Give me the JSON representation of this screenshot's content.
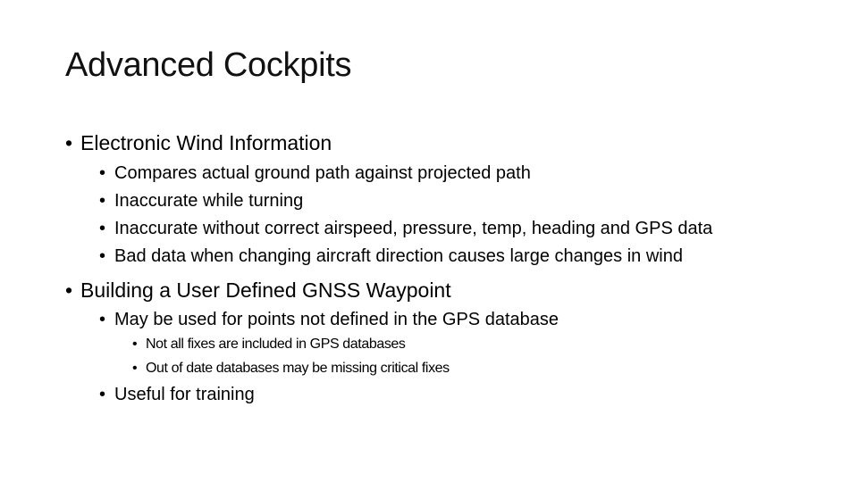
{
  "slide": {
    "title": "Advanced Cockpits",
    "bullet_glyph": "•",
    "sections": [
      {
        "text": "Electronic Wind Information",
        "children": [
          {
            "text": "Compares actual ground path against projected path"
          },
          {
            "text": "Inaccurate while turning"
          },
          {
            "text": "Inaccurate without correct airspeed, pressure, temp, heading and GPS data"
          },
          {
            "text": "Bad data when changing aircraft direction causes large changes in wind"
          }
        ]
      },
      {
        "text": "Building a User Defined GNSS Waypoint",
        "children": [
          {
            "text": "May be used for points not defined in the GPS database",
            "children": [
              {
                "text": "Not all fixes are included in GPS databases"
              },
              {
                "text": "Out of date databases may be missing critical fixes"
              }
            ]
          },
          {
            "text": "Useful for training"
          }
        ]
      }
    ]
  }
}
